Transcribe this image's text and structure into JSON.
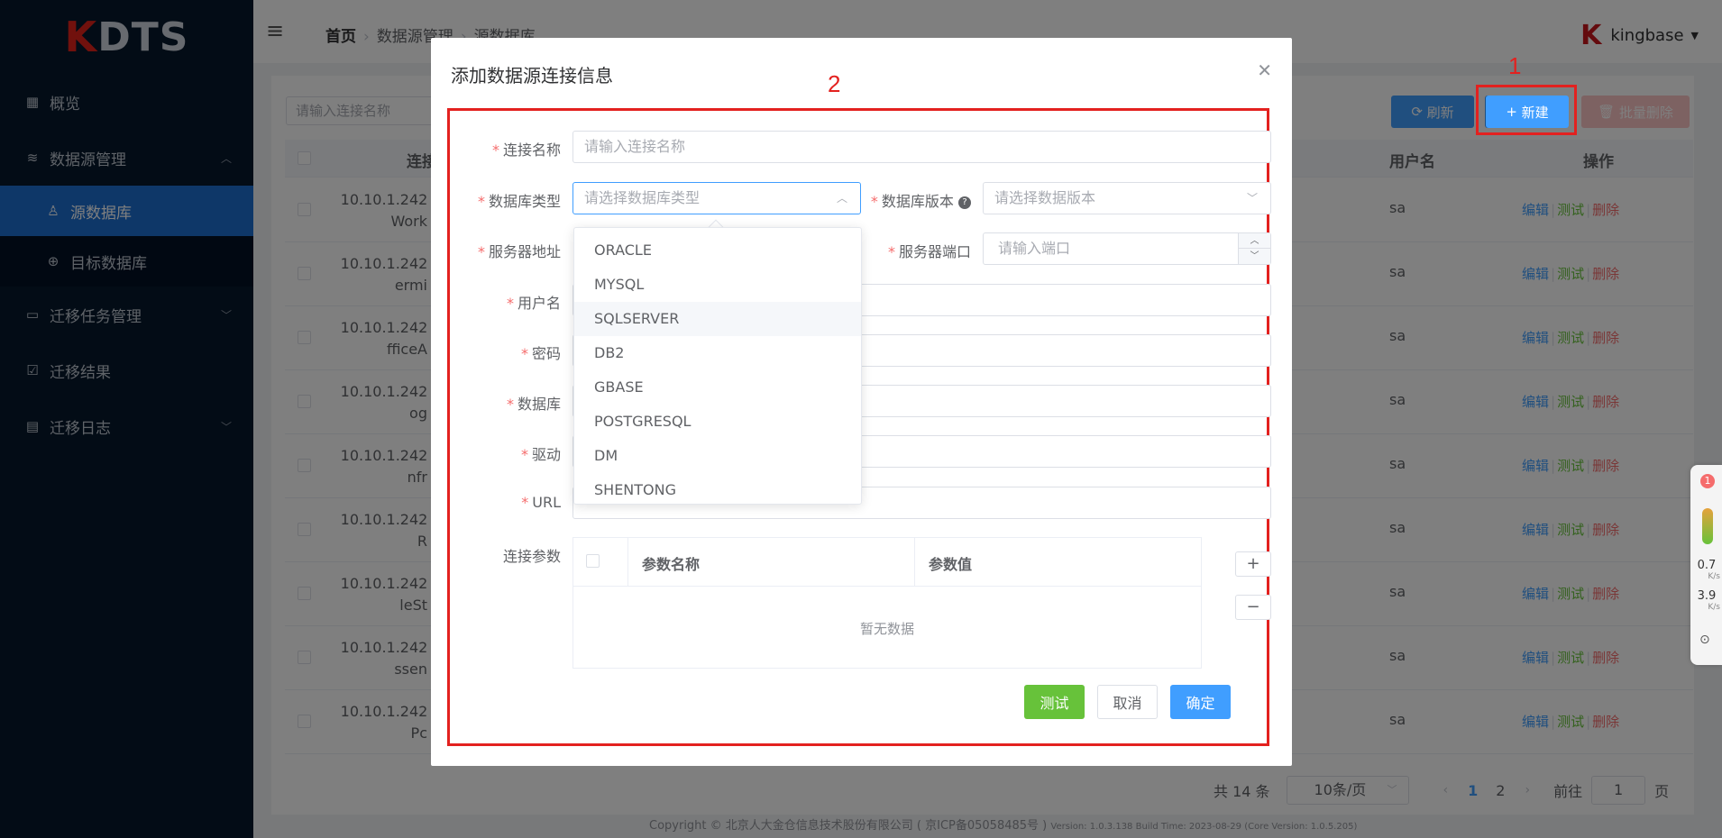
{
  "app": {
    "logo_k": "K",
    "logo_rest": "DTS"
  },
  "sidebar": {
    "items": [
      {
        "label": "概览",
        "icon": "grid-icon"
      },
      {
        "label": "数据源管理",
        "icon": "database-icon",
        "expanded": true
      },
      {
        "label": "源数据库",
        "icon": "user-icon",
        "active": true
      },
      {
        "label": "目标数据库",
        "icon": "target-icon"
      },
      {
        "label": "迁移任务管理",
        "icon": "folder-icon"
      },
      {
        "label": "迁移结果",
        "icon": "checklist-icon"
      },
      {
        "label": "迁移日志",
        "icon": "document-icon"
      }
    ]
  },
  "header": {
    "breadcrumb": [
      "首页",
      "数据源管理",
      "源数据库"
    ],
    "username": "kingbase"
  },
  "toolbar": {
    "search_placeholder": "请输入连接名称",
    "refresh_label": "刷新",
    "new_label": "新建",
    "batch_delete_label": "批量删除"
  },
  "table": {
    "headers": {
      "conn": "连接",
      "user": "用户名",
      "op": "操作"
    },
    "rows": [
      {
        "conn_line1": "10.10.1.242",
        "conn_line2": "Work",
        "user": "sa"
      },
      {
        "conn_line1": "10.10.1.242",
        "conn_line2": "ermi",
        "user": "sa"
      },
      {
        "conn_line1": "10.10.1.242",
        "conn_line2": "fficeA",
        "user": "sa"
      },
      {
        "conn_line1": "10.10.1.242",
        "conn_line2": "og",
        "user": "sa"
      },
      {
        "conn_line1": "10.10.1.242",
        "conn_line2": "nfr",
        "user": "sa"
      },
      {
        "conn_line1": "10.10.1.242",
        "conn_line2": "R",
        "user": "sa"
      },
      {
        "conn_line1": "10.10.1.242",
        "conn_line2": "leSt",
        "user": "sa"
      },
      {
        "conn_line1": "10.10.1.242",
        "conn_line2": "ssen",
        "user": "sa"
      },
      {
        "conn_line1": "10.10.1.242",
        "conn_line2": "Pc",
        "user": "sa"
      }
    ],
    "ops": {
      "edit": "编辑",
      "test": "测试",
      "delete": "删除"
    }
  },
  "pagination": {
    "total": "共 14 条",
    "page_size": "10条/页",
    "pages": [
      "1",
      "2"
    ],
    "current": "1",
    "goto_prefix": "前往",
    "goto_value": "1",
    "goto_suffix": "页"
  },
  "footer": {
    "copyright": "Copyright © 北京人大金仓信息技术股份有限公司 ( 京ICP备05058485号 )",
    "version": "Version: 1.0.3.138 Build Time: 2023-08-29 (Core Version: 1.0.5.205)"
  },
  "dialog": {
    "title": "添加数据源连接信息",
    "annotation_1": "1",
    "annotation_2": "2",
    "fields": {
      "conn_name_label": "连接名称",
      "conn_name_placeholder": "请输入连接名称",
      "db_type_label": "数据库类型",
      "db_type_placeholder": "请选择数据库类型",
      "db_version_label": "数据库版本",
      "db_version_placeholder": "请选择数据版本",
      "server_addr_label": "服务器地址",
      "server_port_label": "服务器端口",
      "server_port_placeholder": "请输入端口",
      "username_label": "用户名",
      "password_label": "密码",
      "database_label": "数据库",
      "driver_label": "驱动",
      "url_label": "URL",
      "conn_params_label": "连接参数"
    },
    "dropdown_options": [
      "ORACLE",
      "MYSQL",
      "SQLSERVER",
      "DB2",
      "GBASE",
      "POSTGRESQL",
      "DM",
      "SHENTONG"
    ],
    "dropdown_hover": "SQLSERVER",
    "params_table": {
      "col1": "参数名称",
      "col2": "参数值",
      "empty": "暂无数据"
    },
    "buttons": {
      "test": "测试",
      "cancel": "取消",
      "confirm": "确定"
    }
  },
  "widget": {
    "badge": "1",
    "speed_up": "0.7",
    "speed_down": "3.9",
    "unit": "K/s"
  },
  "colors": {
    "accent": "#409eff",
    "sidebar_bg": "#06182c",
    "sidebar_active": "#1c6fd1",
    "annotation_red": "#e3211f",
    "success": "#67c23a",
    "danger": "#f56c6c"
  }
}
